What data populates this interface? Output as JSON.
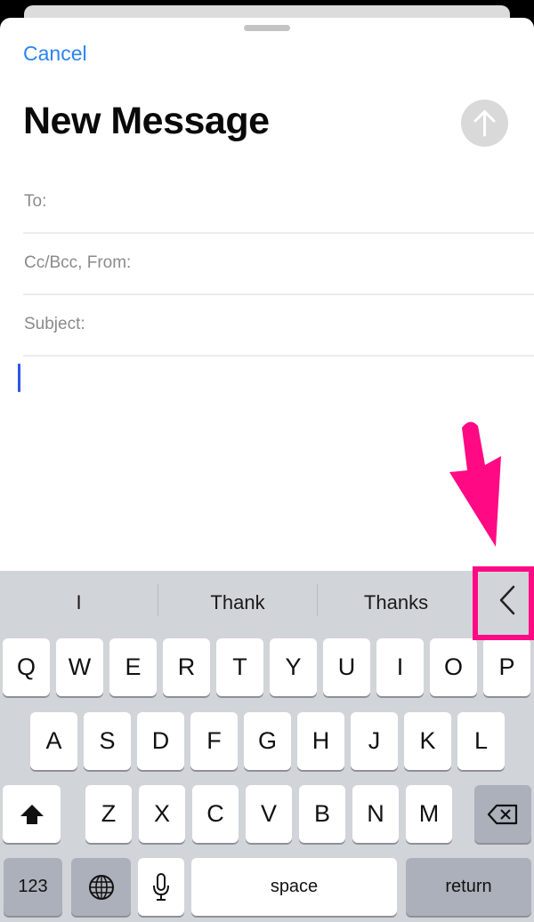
{
  "compose": {
    "cancel_label": "Cancel",
    "title": "New Message",
    "send_icon": "arrow-up-circle-icon",
    "fields": [
      {
        "label": "To:",
        "value": ""
      },
      {
        "label": "Cc/Bcc, From:",
        "value": ""
      },
      {
        "label": "Subject:",
        "value": ""
      }
    ],
    "body": ""
  },
  "keyboard": {
    "predictions": [
      "I",
      "Thank",
      "Thanks"
    ],
    "collapse_icon": "chevron-left-icon",
    "rows": [
      [
        "Q",
        "W",
        "E",
        "R",
        "T",
        "Y",
        "U",
        "I",
        "O",
        "P"
      ],
      [
        "A",
        "S",
        "D",
        "F",
        "G",
        "H",
        "J",
        "K",
        "L"
      ],
      [
        "Z",
        "X",
        "C",
        "V",
        "B",
        "N",
        "M"
      ]
    ],
    "shift_icon": "shift-icon",
    "delete_icon": "delete-icon",
    "numbers_label": "123",
    "globe_icon": "globe-icon",
    "mic_icon": "microphone-icon",
    "space_label": "space",
    "return_label": "return"
  },
  "annotation": {
    "color": "#ff0a84",
    "arrow_icon": "pointing-arrow-icon",
    "target": "predictions-collapse-button"
  }
}
